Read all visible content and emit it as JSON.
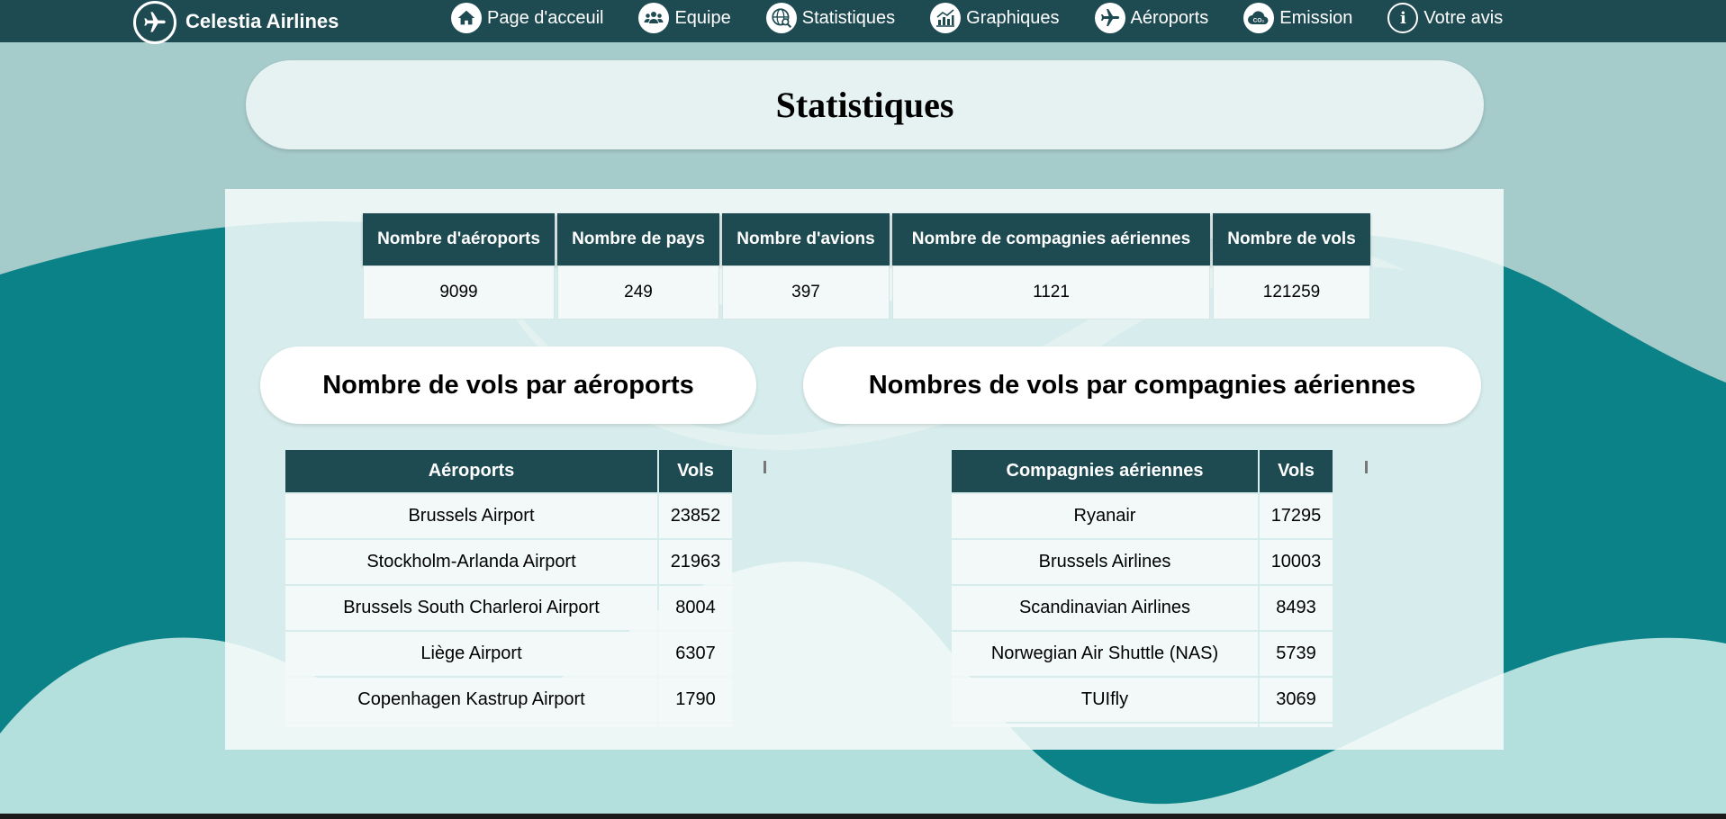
{
  "brand": {
    "name": "Celestia Airlines"
  },
  "nav": [
    {
      "label": "Page d'acceuil",
      "icon": "home-icon"
    },
    {
      "label": "Equipe",
      "icon": "team-icon"
    },
    {
      "label": "Statistiques",
      "icon": "stats-globe-icon"
    },
    {
      "label": "Graphiques",
      "icon": "chart-icon"
    },
    {
      "label": "Aéroports",
      "icon": "plane-icon"
    },
    {
      "label": "Emission",
      "icon": "co2-cloud-icon"
    },
    {
      "label": "Votre avis",
      "icon": "info-icon"
    }
  ],
  "page": {
    "title": "Statistiques"
  },
  "totals": {
    "headers": [
      "Nombre d'aéroports",
      "Nombre de pays",
      "Nombre d'avions",
      "Nombre de compagnies aériennes",
      "Nombre de vols"
    ],
    "values": [
      "9099",
      "249",
      "397",
      "1121",
      "121259"
    ]
  },
  "airports_section": {
    "title": "Nombre de vols par aéroports",
    "headers": [
      "Aéroports",
      "Vols"
    ],
    "rows": [
      [
        "Brussels Airport",
        "23852"
      ],
      [
        "Stockholm-Arlanda Airport",
        "21963"
      ],
      [
        "Brussels South Charleroi Airport",
        "8004"
      ],
      [
        "Liège Airport",
        "6307"
      ],
      [
        "Copenhagen Kastrup Airport",
        "1790"
      ]
    ]
  },
  "airlines_section": {
    "title": "Nombres de vols par compagnies aériennes",
    "headers": [
      "Compagnies aériennes",
      "Vols"
    ],
    "rows": [
      [
        "Ryanair",
        "17295"
      ],
      [
        "Brussels Airlines",
        "10003"
      ],
      [
        "Scandinavian Airlines",
        "8493"
      ],
      [
        "Norwegian Air Shuttle (NAS)",
        "5739"
      ],
      [
        "TUIfly",
        "3069"
      ]
    ]
  },
  "colors": {
    "nav_bg": "#1e4a52",
    "header_cell": "#1e4a52",
    "wave_dark": "#0b8288",
    "wave_light": "#b3dfdc",
    "background": "#a6cbcb"
  }
}
